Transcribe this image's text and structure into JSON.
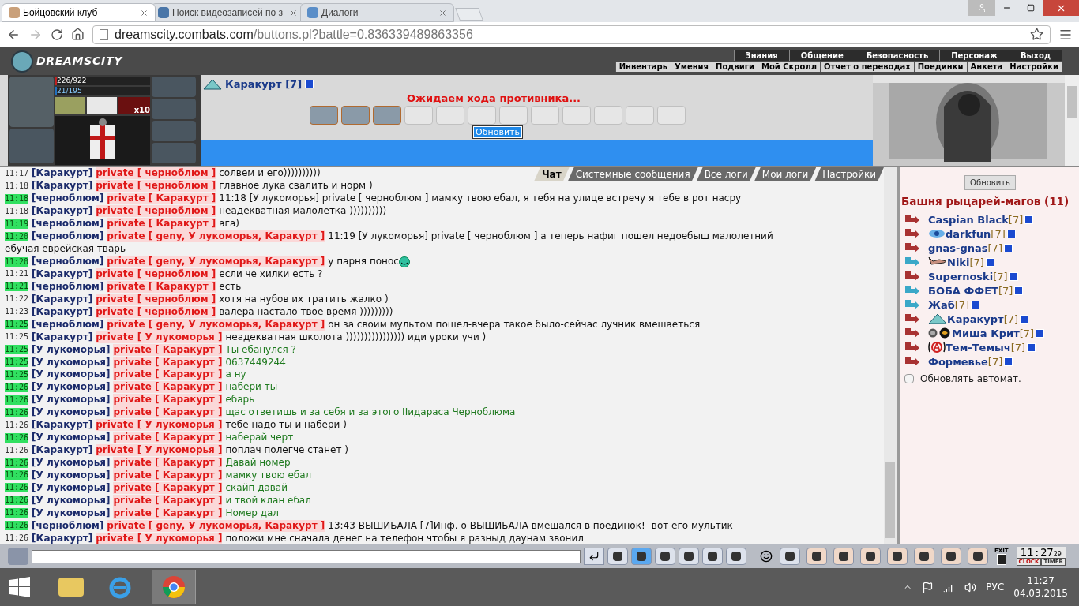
{
  "browser": {
    "tabs": [
      {
        "label": "Бойцовский клуб",
        "selected": true
      },
      {
        "label": "Поиск видеозаписей по з",
        "selected": false
      },
      {
        "label": "Диалоги",
        "selected": false
      }
    ],
    "url_host": "dreamscity.combats.com",
    "url_path": "/buttons.pl?battle=0.836339489863356"
  },
  "game_header": {
    "logo": "DREAMSCITY",
    "menu": [
      "Знания",
      "Общение",
      "Безопасность",
      "Персонаж",
      "Выход"
    ],
    "submenu": [
      "Инвентарь",
      "Умения",
      "Подвиги",
      "Мой Скролл",
      "Отчет о переводах",
      "Поединки",
      "Анкета",
      "Настройки"
    ]
  },
  "battle": {
    "hp": {
      "value": "226/922",
      "level": 0.245
    },
    "mana": {
      "value": "21/195",
      "level": 0.108
    },
    "item_count": "x10",
    "opponent": "Каракурт [7]",
    "status": "Ожидаем хода противника...",
    "refresh": "Обновить",
    "slots": [
      {
        "filled": true
      },
      {
        "filled": true
      },
      {
        "filled": true
      },
      {
        "filled": false
      },
      {
        "filled": false
      },
      {
        "filled": false
      },
      {
        "filled": false
      },
      {
        "filled": false
      },
      {
        "filled": false
      },
      {
        "filled": false
      },
      {
        "filled": false
      },
      {
        "filled": false
      }
    ]
  },
  "chat_tabs": [
    {
      "label": "Чат",
      "selected": true
    },
    {
      "label": "Системные сообщения",
      "selected": false
    },
    {
      "label": "Все логи",
      "selected": false
    },
    {
      "label": "Мои логи",
      "selected": false
    },
    {
      "label": "Настройки",
      "selected": false
    }
  ],
  "chat": [
    {
      "time": "11:17",
      "hl": false,
      "from": "[Каракурт]",
      "to": "private [ черноблюм ]",
      "text": "солвем и его))))))))))",
      "green": false
    },
    {
      "time": "11:18",
      "hl": false,
      "from": "[Каракурт]",
      "to": "private [ черноблюм ]",
      "text": "главное лука свалить и норм )",
      "green": false
    },
    {
      "time": "11:18",
      "hl": true,
      "from": "[черноблюм]",
      "to": "private [ Каракурт ]",
      "text": "11:18 [У лукоморья] private [ черноблюм ] мамку твою ебал, я тебя на улице встречу я тебе в рот насру",
      "green": false
    },
    {
      "time": "11:18",
      "hl": false,
      "from": "[Каракурт]",
      "to": "private [ черноблюм ]",
      "text": "неадекватная малолетка ))))))))))",
      "green": false
    },
    {
      "time": "11:19",
      "hl": true,
      "from": "[черноблюм]",
      "to": "private [ Каракурт ]",
      "text": "ага)",
      "green": false
    },
    {
      "time": "11:20",
      "hl": true,
      "from": "[черноблюм]",
      "to": "private [ geny, У лукоморья, Каракурт ]",
      "text": "11:19 [У лукоморья] private [ черноблюм ] а теперь нафиг пошел недоебыш малолетний",
      "continuation": "ебучая еврейская тварь",
      "green": false
    },
    {
      "time": "11:20",
      "hl": true,
      "from": "[черноблюм]",
      "to": "private [ geny, У лукоморья, Каракурт ]",
      "text": "у парня понос",
      "green": false,
      "smiley": true
    },
    {
      "time": "11:21",
      "hl": false,
      "from": "[Каракурт]",
      "to": "private [ черноблюм ]",
      "text": "если че хилки есть ?",
      "green": false
    },
    {
      "time": "11:21",
      "hl": true,
      "from": "[черноблюм]",
      "to": "private [ Каракурт ]",
      "text": "есть",
      "green": false
    },
    {
      "time": "11:22",
      "hl": false,
      "from": "[Каракурт]",
      "to": "private [ черноблюм ]",
      "text": "хотя на нубов их тратить жалко )",
      "green": false
    },
    {
      "time": "11:23",
      "hl": false,
      "from": "[Каракурт]",
      "to": "private [ черноблюм ]",
      "text": "валера настало твое время )))))))))",
      "green": false
    },
    {
      "time": "11:25",
      "hl": true,
      "from": "[черноблюм]",
      "to": "private [ geny, У лукоморья, Каракурт ]",
      "text": "он за своим мультом пошел-вчера такое было-сейчас лучник вмешаеться",
      "green": false
    },
    {
      "time": "11:25",
      "hl": false,
      "from": "[Каракурт]",
      "to": "private [ У лукоморья ]",
      "text": "неадекватная школота )))))))))))))))) иди уроки учи )",
      "green": false
    },
    {
      "time": "11:25",
      "hl": true,
      "from": "[У лукоморья]",
      "to": "private [ Каракурт ]",
      "text": "Ты ебанулся ?",
      "green": true
    },
    {
      "time": "11:25",
      "hl": true,
      "from": "[У лукоморья]",
      "to": "private [ Каракурт ]",
      "text": "0637449244",
      "green": true
    },
    {
      "time": "11:25",
      "hl": true,
      "from": "[У лукоморья]",
      "to": "private [ Каракурт ]",
      "text": "а ну",
      "green": true
    },
    {
      "time": "11:26",
      "hl": true,
      "from": "[У лукоморья]",
      "to": "private [ Каракурт ]",
      "text": "набери ты",
      "green": true
    },
    {
      "time": "11:26",
      "hl": true,
      "from": "[У лукоморья]",
      "to": "private [ Каракурт ]",
      "text": "ебарь",
      "green": true
    },
    {
      "time": "11:26",
      "hl": true,
      "from": "[У лукоморья]",
      "to": "private [ Каракурт ]",
      "text": "щас ответишь и за себя и за этого IIидараса Черноблюма",
      "green": true
    },
    {
      "time": "11:26",
      "hl": false,
      "from": "[Каракурт]",
      "to": "private [ У лукоморья ]",
      "text": "тебе надо ты и набери )",
      "green": false
    },
    {
      "time": "11:26",
      "hl": true,
      "from": "[У лукоморья]",
      "to": "private [ Каракурт ]",
      "text": "наберай черт",
      "green": true
    },
    {
      "time": "11:26",
      "hl": false,
      "from": "[Каракурт]",
      "to": "private [ У лукоморья ]",
      "text": "поплач полегче станет )",
      "green": false
    },
    {
      "time": "11:26",
      "hl": true,
      "from": "[У лукоморья]",
      "to": "private [ Каракурт ]",
      "text": "Давай номер",
      "green": true
    },
    {
      "time": "11:26",
      "hl": true,
      "from": "[У лукоморья]",
      "to": "private [ Каракурт ]",
      "text": "мамку твою ебал",
      "green": true
    },
    {
      "time": "11:26",
      "hl": true,
      "from": "[У лукоморья]",
      "to": "private [ Каракурт ]",
      "text": "скайп давай",
      "green": true
    },
    {
      "time": "11:26",
      "hl": true,
      "from": "[У лукоморья]",
      "to": "private [ Каракурт ]",
      "text": "и твой клан ебал",
      "green": true
    },
    {
      "time": "11:26",
      "hl": true,
      "from": "[У лукоморья]",
      "to": "private [ Каракурт ]",
      "text": "Номер дал",
      "green": true
    },
    {
      "time": "11:26",
      "hl": true,
      "from": "[черноблюм]",
      "to": "private [ geny, У лукоморья, Каракурт ]",
      "text": "13:43 ВЫШИБАЛА [7]Инф. о ВЫШИБАЛА вмешался в поединок! -вот его мультик",
      "green": false
    },
    {
      "time": "11:26",
      "hl": false,
      "from": "[Каракурт]",
      "to": "private [ У лукоморья ]",
      "text": "положи мне сначала денег на телефон чтобы я разныд даунам звонил",
      "green": false
    }
  ],
  "room": {
    "refresh": "Обновить",
    "title": "Башня рыцарей-магов (11)",
    "auto_refresh": {
      "label": "Обновлять автомат.",
      "checked": false
    },
    "players": [
      {
        "name": "Caspian Black",
        "level": "[7]",
        "color": "#a83232",
        "kind": "plain"
      },
      {
        "name": "darkfun",
        "level": "[7]",
        "color": "#a83232",
        "kind": "eye"
      },
      {
        "name": "gnas-gnas",
        "level": "[7]",
        "color": "#a83232",
        "kind": "plain"
      },
      {
        "name": "Niki",
        "level": "[7]",
        "color": "#3aa8c8",
        "kind": "hand"
      },
      {
        "name": "Supernoski",
        "level": "[7]",
        "color": "#a83232",
        "kind": "plain"
      },
      {
        "name": "БОБА ФФЕТ",
        "level": "[7]",
        "color": "#3aa8c8",
        "kind": "plain"
      },
      {
        "name": "Жаб",
        "level": "[7]",
        "color": "#3aa8c8",
        "kind": "plain"
      },
      {
        "name": "Каракурт",
        "level": "[7]",
        "color": "#a83232",
        "kind": "triangle"
      },
      {
        "name": "Миша Крит",
        "level": "[7]",
        "color": "#a83232",
        "kind": "medal"
      },
      {
        "name": "Тем-Темыч",
        "level": "[7]",
        "color": "#a83232",
        "kind": "anarchy"
      },
      {
        "name": "Формевье",
        "level": "[7]",
        "color": "#a83232",
        "kind": "plain"
      }
    ]
  },
  "clock": {
    "time": "11:27",
    "seconds": "29",
    "clock_label": "CLOCK",
    "timer_label": "TIMER",
    "exit_label": "EXIT"
  },
  "taskbar": {
    "language": "РУС",
    "time": "11:27",
    "date": "04.03.2015"
  }
}
